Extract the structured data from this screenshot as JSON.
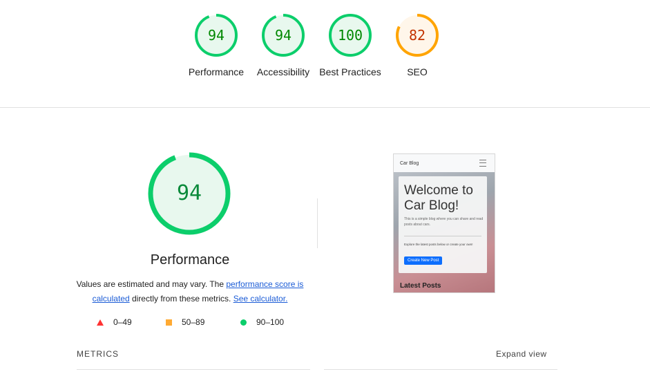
{
  "category_gauges": [
    {
      "score": "94",
      "label": "Performance",
      "fraction": 0.94,
      "ring_color": "#0cce6b",
      "fill_color": "#e8f8ee",
      "text_color": "#008800"
    },
    {
      "score": "94",
      "label": "Accessibility",
      "fraction": 0.94,
      "ring_color": "#0cce6b",
      "fill_color": "#e8f8ee",
      "text_color": "#008800"
    },
    {
      "score": "100",
      "label": "Best Practices",
      "fraction": 1.0,
      "ring_color": "#0cce6b",
      "fill_color": "#e8f8ee",
      "text_color": "#008800"
    },
    {
      "score": "82",
      "label": "SEO",
      "fraction": 0.82,
      "ring_color": "#ffa400",
      "fill_color": "#fff6ea",
      "text_color": "#c33300"
    }
  ],
  "performance": {
    "score": "94",
    "fraction": 0.94,
    "title": "Performance",
    "desc_prefix": "Values are estimated and may vary. The ",
    "score_link": "performance score is calculated",
    "desc_middle": " directly from these metrics. ",
    "calc_link": "See calculator."
  },
  "legend": [
    {
      "range": "0–49",
      "shape": "triangle",
      "color": "#ff3333"
    },
    {
      "range": "50–89",
      "shape": "square",
      "color": "#ffaa33"
    },
    {
      "range": "90–100",
      "shape": "circle",
      "color": "#0cce6b"
    }
  ],
  "screenshot": {
    "brand": "Car Blog",
    "heading": "Welcome to Car Blog!",
    "lead": "This is a simple blog where you can share and read posts about cars.",
    "small": "Explore the latest posts below or create your own!",
    "button": "Create New Post",
    "latest": "Latest Posts"
  },
  "metrics": {
    "label": "METRICS",
    "expand": "Expand view"
  }
}
